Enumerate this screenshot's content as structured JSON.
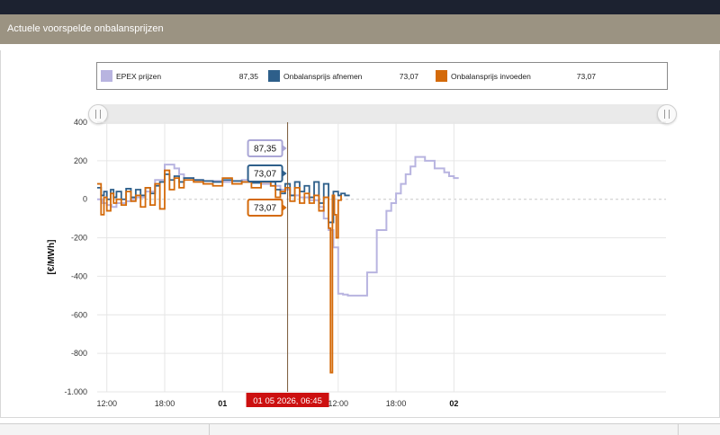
{
  "header": {
    "title": "Actuele voorspelde onbalansprijzen"
  },
  "legend": [
    {
      "name": "EPEX prijzen",
      "value": "87,35",
      "color": "#b8b4e0"
    },
    {
      "name": "Onbalansprijs afnemen",
      "value": "73,07",
      "color": "#2e5f8a"
    },
    {
      "name": "Onbalansprijs invoeden",
      "value": "73,07",
      "color": "#d46a0a"
    }
  ],
  "tooltips": {
    "epex": "87,35",
    "afnemen": "73,07",
    "invoeden": "73,07"
  },
  "crosshair_label": "01 05 2026, 06:45",
  "chart_data": {
    "type": "line",
    "ylabel": "[€/MWh]",
    "ylim": [
      -1000,
      400
    ],
    "yticks": [
      "400",
      "200",
      "0",
      "-200",
      "-400",
      "-600",
      "-800",
      "-1.000"
    ],
    "yticks_values": [
      400,
      200,
      0,
      -200,
      -400,
      -600,
      -800,
      -1000
    ],
    "xlim": [
      -13,
      46
    ],
    "xticks": [
      {
        "hour": -12,
        "label": "12:00",
        "bold": false
      },
      {
        "hour": -6,
        "label": "18:00",
        "bold": false
      },
      {
        "hour": 0,
        "label": "01",
        "bold": true
      },
      {
        "hour": 12,
        "label": "12:00",
        "bold": false
      },
      {
        "hour": 18,
        "label": "18:00",
        "bold": false
      },
      {
        "hour": 24,
        "label": "02",
        "bold": true
      }
    ],
    "crosshair_hour": 6.75,
    "series": [
      {
        "name": "EPEX prijzen",
        "color": "#b8b4e0",
        "x": [
          -13,
          -12.5,
          -12,
          -11.5,
          -11,
          -10,
          -9.5,
          -9,
          -8,
          -7,
          -6,
          -5.5,
          -5,
          -4.5,
          -4,
          -3,
          -2,
          -1,
          0,
          1,
          2,
          3,
          4,
          5,
          6,
          7,
          8,
          9,
          10,
          10.5,
          11,
          11.5,
          12,
          12.5,
          13,
          14,
          15,
          16,
          17,
          17.5,
          18,
          18.5,
          19,
          19.5,
          20,
          21,
          22,
          23,
          23.5,
          24,
          24.5
        ],
        "values": [
          0,
          -20,
          -30,
          -40,
          -20,
          -10,
          0,
          10,
          40,
          100,
          180,
          180,
          160,
          130,
          110,
          100,
          95,
          95,
          90,
          95,
          100,
          90,
          80,
          70,
          50,
          20,
          10,
          -5,
          -40,
          -100,
          -160,
          -250,
          -490,
          -495,
          -500,
          -500,
          -380,
          -160,
          -60,
          -20,
          30,
          80,
          130,
          170,
          220,
          200,
          160,
          140,
          120,
          110,
          110
        ]
      },
      {
        "name": "Onbalansprijs afnemen",
        "color": "#2e5f8a",
        "x": [
          -13,
          -12.6,
          -12.3,
          -12,
          -11.6,
          -11.3,
          -11,
          -10.5,
          -10,
          -9.5,
          -9,
          -8.5,
          -8,
          -7.5,
          -7,
          -6.5,
          -6,
          -5.5,
          -5,
          -4.5,
          -4,
          -3,
          -2,
          -1,
          0,
          1,
          2,
          3,
          4,
          5,
          5.5,
          6,
          6.5,
          7,
          7.5,
          8,
          8.5,
          9,
          9.5,
          10,
          10.5,
          11,
          11.5,
          12,
          12.3,
          12.7,
          13.2
        ],
        "values": [
          60,
          20,
          40,
          0,
          50,
          10,
          40,
          0,
          55,
          10,
          50,
          20,
          60,
          30,
          70,
          90,
          130,
          100,
          120,
          90,
          110,
          100,
          95,
          90,
          100,
          95,
          90,
          85,
          100,
          90,
          50,
          30,
          80,
          20,
          90,
          40,
          70,
          10,
          90,
          -20,
          80,
          -120,
          40,
          20,
          30,
          20,
          20
        ]
      },
      {
        "name": "Onbalansprijs invoeden",
        "color": "#d46a0a",
        "x": [
          -13,
          -12.6,
          -12.3,
          -12,
          -11.6,
          -11.3,
          -11,
          -10.5,
          -10,
          -9.5,
          -9,
          -8.5,
          -8,
          -7.5,
          -7,
          -6.5,
          -6,
          -5.5,
          -5,
          -4.5,
          -4,
          -3,
          -2,
          -1,
          0,
          1,
          2,
          3,
          4,
          5,
          5.5,
          6,
          6.5,
          7,
          7.5,
          8,
          8.5,
          9,
          9.5,
          10,
          10.5,
          11,
          11.2,
          11.4,
          11.6,
          11.8,
          12,
          12.3
        ],
        "values": [
          80,
          -80,
          10,
          -60,
          30,
          -20,
          0,
          -30,
          40,
          -10,
          20,
          -40,
          60,
          -30,
          80,
          -50,
          150,
          50,
          110,
          60,
          100,
          90,
          80,
          70,
          110,
          80,
          90,
          60,
          90,
          70,
          10,
          40,
          60,
          -10,
          60,
          -20,
          30,
          -20,
          20,
          -60,
          10,
          -150,
          -900,
          20,
          -80,
          -200,
          -5,
          20
        ]
      }
    ]
  }
}
